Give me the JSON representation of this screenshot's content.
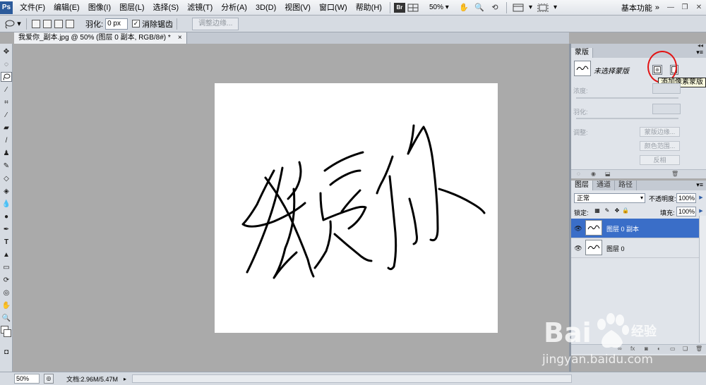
{
  "menubar": {
    "logo": "Ps",
    "items": [
      "文件(F)",
      "编辑(E)",
      "图像(I)",
      "图层(L)",
      "选择(S)",
      "滤镜(T)",
      "分析(A)",
      "3D(D)",
      "视图(V)",
      "窗口(W)",
      "帮助(H)"
    ],
    "bridge": "Br",
    "zoom": "50%",
    "workspace": "基本功能"
  },
  "options": {
    "feather_label": "羽化:",
    "feather_value": "0 px",
    "antialias_label": "消除锯齿",
    "antialias_checked": "✓",
    "refine_edge": "调整边缘..."
  },
  "document": {
    "tab_title": "我爱你_副本.jpg @ 50% (图层 0 副本, RGB/8#) *",
    "close": "×"
  },
  "status": {
    "zoom": "50%",
    "doc_size": "文档:2.96M/5.47M"
  },
  "masks_panel": {
    "tab": "蒙版",
    "status": "未选择蒙版",
    "tooltip": "添加像素蒙版",
    "density_label": "浓度:",
    "feather_label": "羽化:",
    "refine_label": "调整:",
    "mask_edge_btn": "蒙版边缘...",
    "color_range_btn": "颜色范围...",
    "invert_btn": "反相"
  },
  "layers_panel": {
    "tabs": [
      "图层",
      "通道",
      "路径"
    ],
    "blend_mode": "正常",
    "opacity_label": "不透明度:",
    "opacity_value": "100%",
    "lock_label": "锁定:",
    "fill_label": "填充:",
    "fill_value": "100%",
    "layers": [
      {
        "name": "图层 0 副本",
        "selected": true
      },
      {
        "name": "图层 0",
        "selected": false
      }
    ]
  },
  "watermark": {
    "brand": "Bai",
    "brand_cn": "经验",
    "url": "jingyan.baidu.com"
  },
  "colors": {
    "accent": "#3a6ec8",
    "annotation": "#e21313",
    "tooltip_bg": "#ffffe1"
  }
}
